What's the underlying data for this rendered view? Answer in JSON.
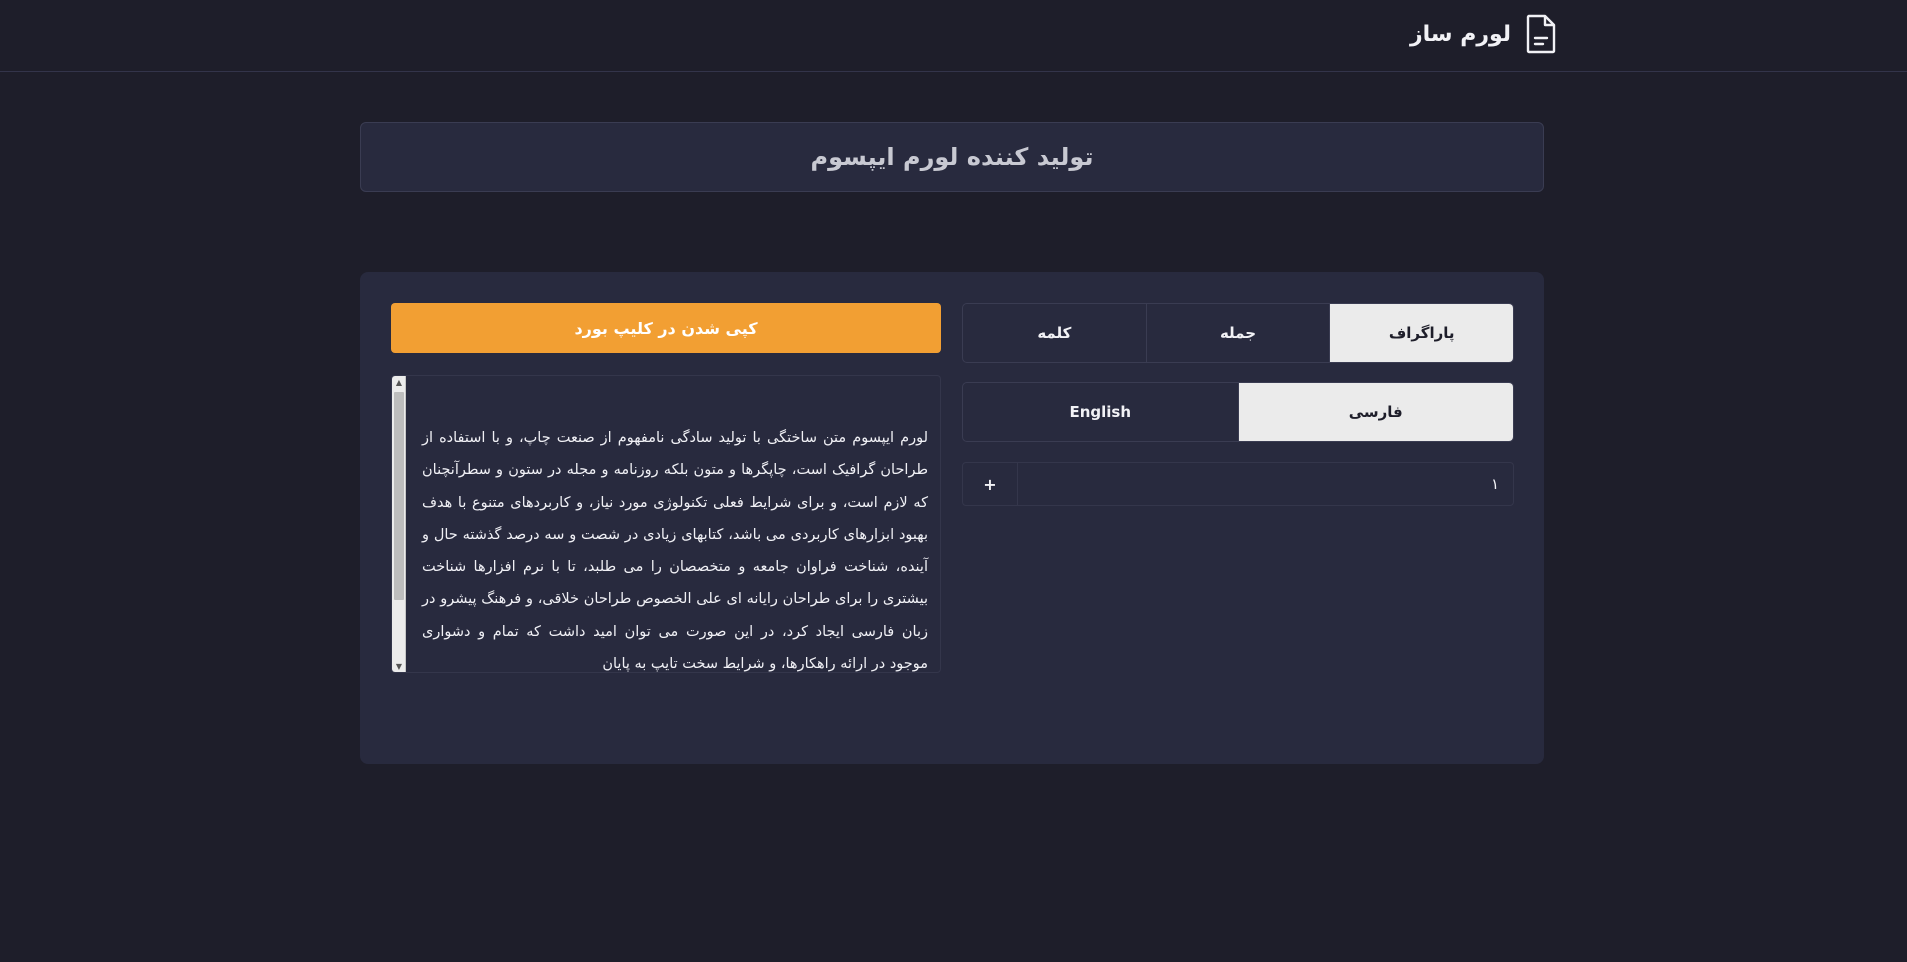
{
  "header": {
    "brand_title": "لورم ساز",
    "brand_icon": "document-icon"
  },
  "hero": {
    "title": "تولید کننده لورم ایپسوم"
  },
  "actions": {
    "copy_label": "کپی شدن در کلیپ بورد"
  },
  "output": {
    "text": "لورم ایپسوم متن ساختگی با تولید سادگی نامفهوم از صنعت چاپ، و با استفاده از طراحان گرافیک است، چاپگرها و متون بلکه روزنامه و مجله در ستون و سطرآنچنان که لازم است، و برای شرایط فعلی تکنولوژی مورد نیاز، و کاربردهای متنوع با هدف بهبود ابزارهای کاربردی می باشد، کتابهای زیادی در شصت و سه درصد گذشته حال و آینده، شناخت فراوان جامعه و متخصصان را می طلبد، تا با نرم افزارها شناخت بیشتری را برای طراحان رایانه ای علی الخصوص طراحان خلاقی، و فرهنگ پیشرو در زبان فارسی ایجاد کرد، در این صورت می توان امید داشت که تمام و دشواری موجود در ارائه راهکارها، و شرایط سخت تایپ به پایان"
  },
  "mode_tabs": {
    "paragraph": "پاراگراف",
    "sentence": "جمله",
    "word": "کلمه",
    "active": "paragraph"
  },
  "lang_tabs": {
    "persian": "فارسی",
    "english": "English",
    "active": "persian"
  },
  "counter": {
    "value": "۱",
    "plus_label": "+"
  },
  "colors": {
    "background": "#1e1e2a",
    "panel": "#282a3e",
    "accent": "#f29f33",
    "active_tab": "#ebebeb"
  }
}
